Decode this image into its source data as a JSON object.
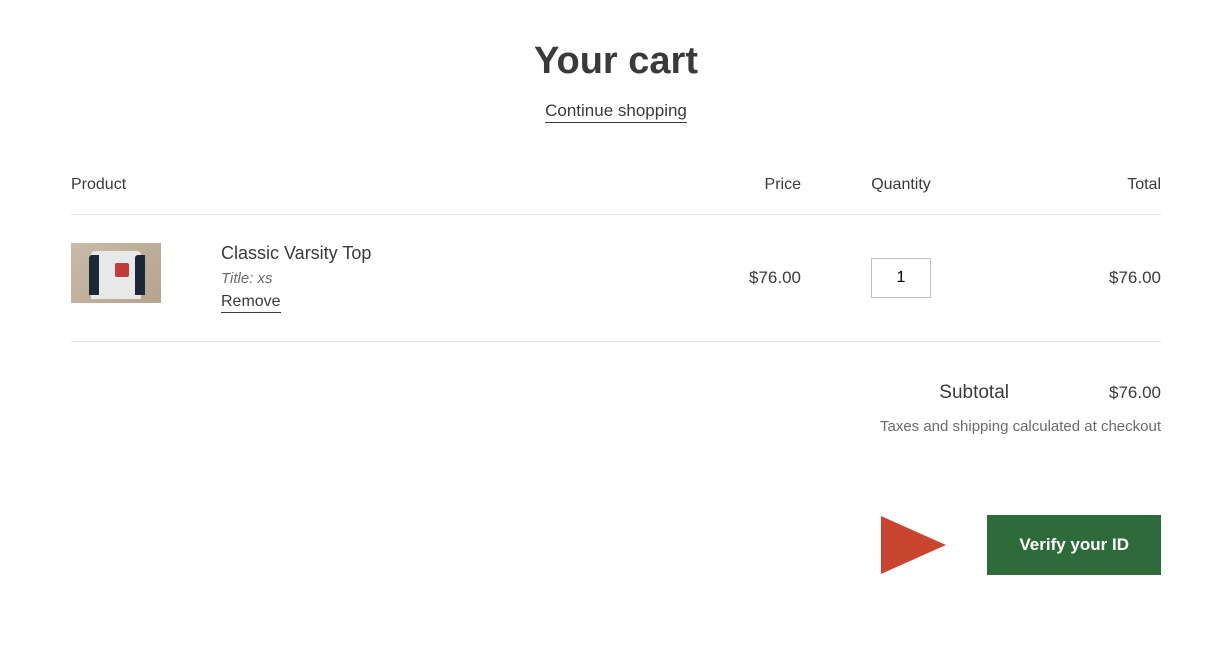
{
  "header": {
    "title": "Your cart",
    "continue_shopping_label": "Continue shopping"
  },
  "columns": {
    "product": "Product",
    "price": "Price",
    "quantity": "Quantity",
    "total": "Total"
  },
  "cart": {
    "items": [
      {
        "name": "Classic Varsity Top",
        "variant_label": "Title: xs",
        "remove_label": "Remove",
        "price": "$76.00",
        "quantity": "1",
        "line_total": "$76.00"
      }
    ]
  },
  "summary": {
    "subtotal_label": "Subtotal",
    "subtotal_value": "$76.00",
    "tax_note": "Taxes and shipping calculated at checkout"
  },
  "actions": {
    "verify_label": "Verify your ID"
  },
  "annotation": {
    "arrow_color": "#d9543f"
  }
}
